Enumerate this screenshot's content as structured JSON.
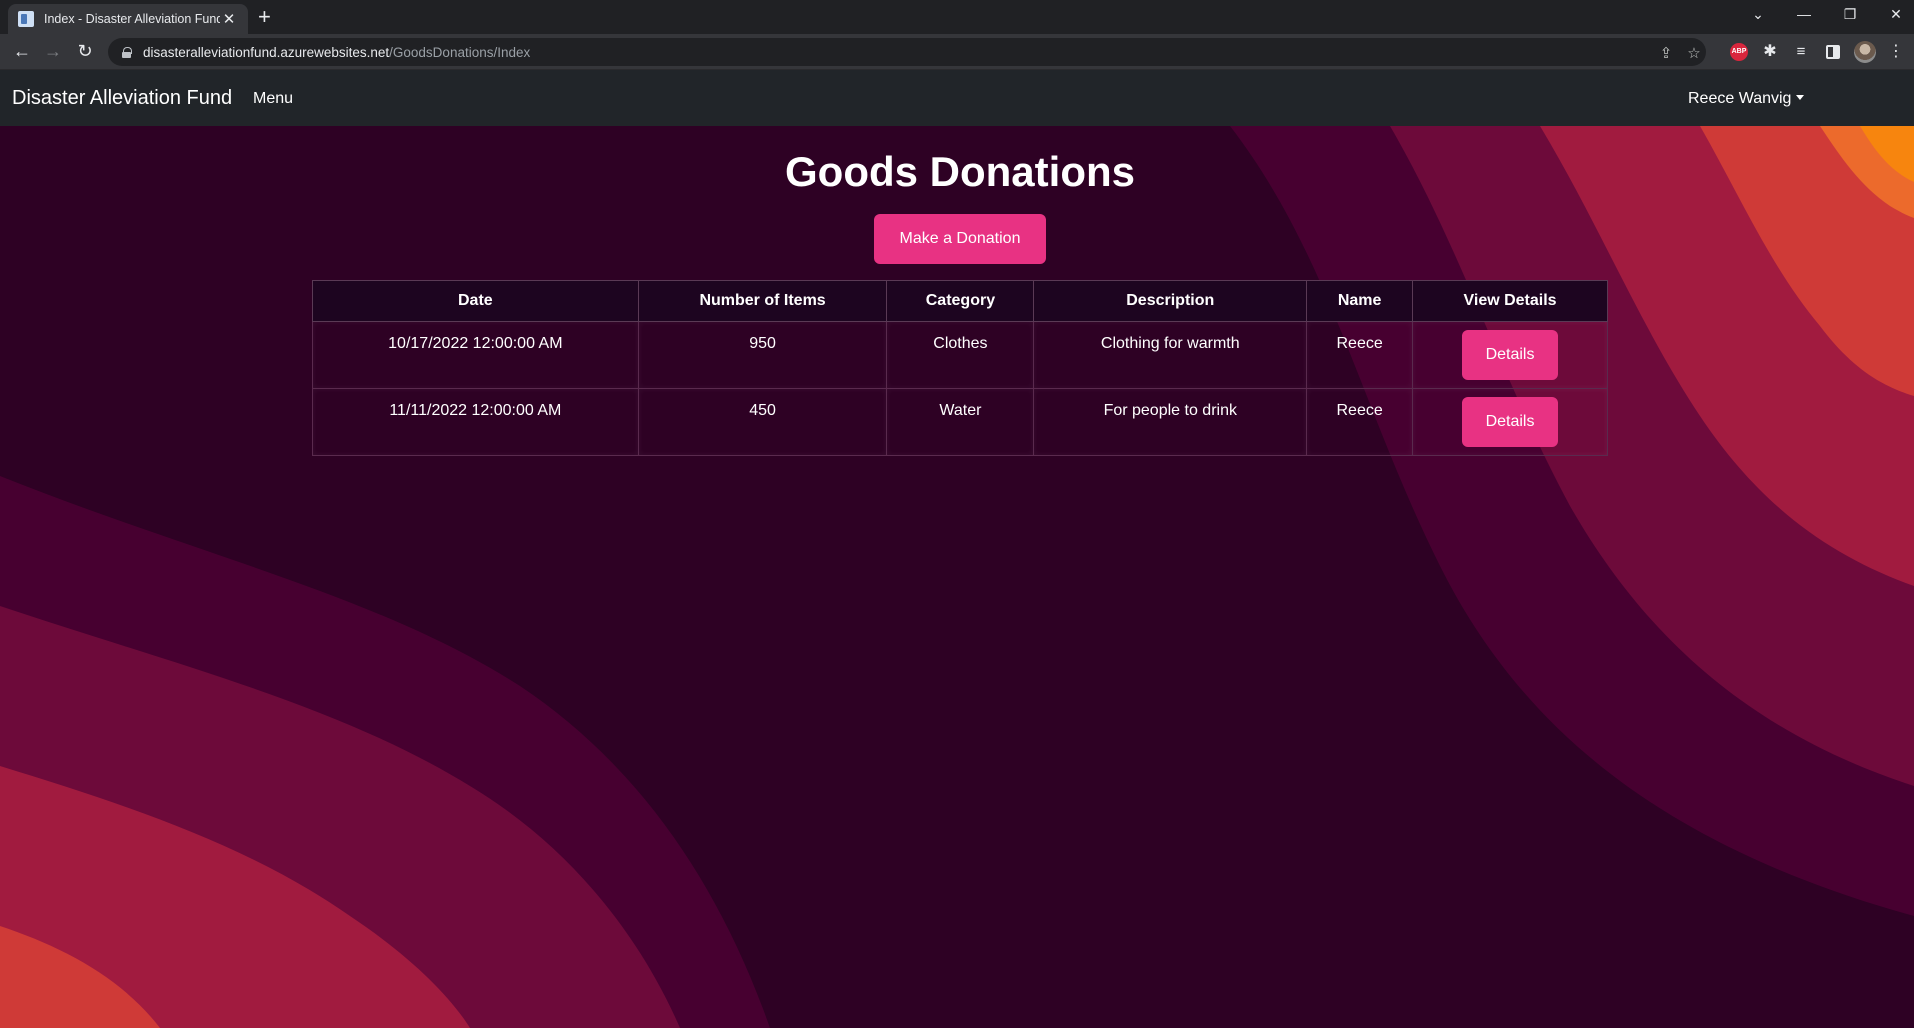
{
  "browser": {
    "tab_title": "Index - Disaster Alleviation Fund",
    "url_domain": "disasteralleviationfund.azurewebsites.net",
    "url_path": "/GoodsDonations/Index",
    "abp_label": "ABP"
  },
  "navbar": {
    "brand": "Disaster Alleviation Fund",
    "menu_label": "Menu",
    "user_name": "Reece Wanvig"
  },
  "page": {
    "title": "Goods Donations",
    "make_donation_label": "Make a Donation"
  },
  "table": {
    "headers": [
      "Date",
      "Number of Items",
      "Category",
      "Description",
      "Name",
      "View Details"
    ],
    "rows": [
      {
        "date": "10/17/2022 12:00:00 AM",
        "items": "950",
        "category": "Clothes",
        "description": "Clothing for warmth",
        "name": "Reece",
        "action": "Details"
      },
      {
        "date": "11/11/2022 12:00:00 AM",
        "items": "450",
        "category": "Water",
        "description": "For people to drink",
        "name": "Reece",
        "action": "Details"
      }
    ]
  },
  "colors": {
    "accent": "#e83283",
    "page_background": "#2e0124",
    "navbar_background": "#212529"
  }
}
